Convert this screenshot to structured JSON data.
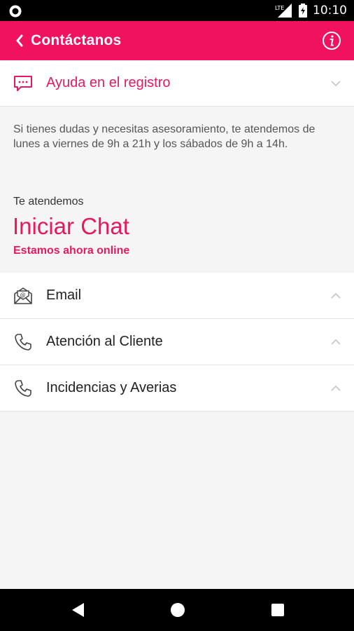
{
  "status_bar": {
    "time": "10:10",
    "network": "LTE"
  },
  "header": {
    "title": "Contáctanos"
  },
  "sections": {
    "registro": {
      "label": "Ayuda en el registro",
      "icon": "chat-bubble-icon"
    },
    "help_text": "Si tienes dudas y necesitas asesoramiento, te atendemos de lunes a viernes de 9h a 21h y los sábados de 9h a 14h.",
    "attend_label": "Te atendemos",
    "chat_label": "Iniciar Chat",
    "online_status": "Estamos ahora online",
    "email": {
      "label": "Email",
      "icon": "email-icon"
    },
    "cliente": {
      "label": "Atención al Cliente",
      "icon": "phone-icon"
    },
    "incidencias": {
      "label": "Incidencias y Averias",
      "icon": "phone-icon"
    }
  },
  "colors": {
    "brand": "#f0115f",
    "accent_text": "#e8185f"
  }
}
